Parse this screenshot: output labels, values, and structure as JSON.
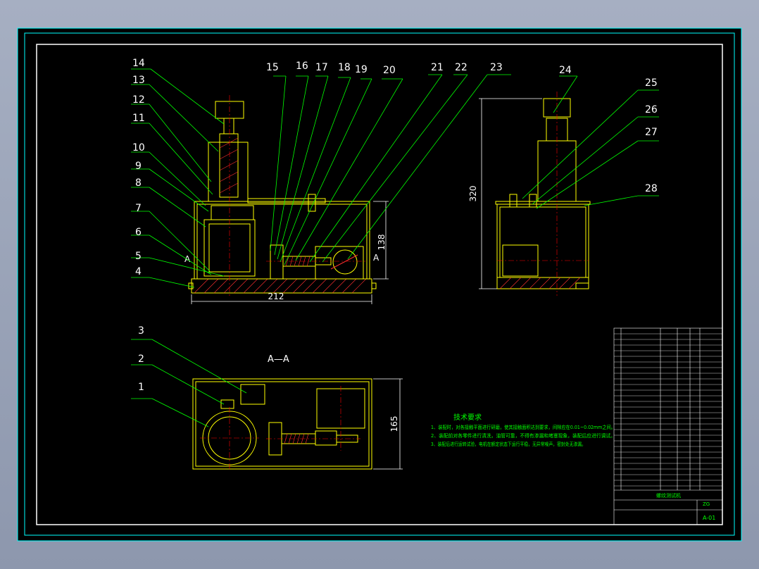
{
  "callouts": {
    "left_stack": [
      "14",
      "13",
      "12",
      "11",
      "10",
      "9",
      "8",
      "7",
      "6",
      "5",
      "4"
    ],
    "top_row": [
      "15",
      "16",
      "17",
      "18",
      "19",
      "20",
      "21",
      "22",
      "23"
    ],
    "side_view": [
      "24",
      "25",
      "26",
      "27",
      "28"
    ],
    "plan_view": [
      "3",
      "2",
      "1"
    ]
  },
  "dimensions": {
    "front_width": "212",
    "front_height": "138",
    "side_height": "320",
    "plan_height": "165"
  },
  "section": {
    "cut_label_left": "A",
    "cut_label_right": "A",
    "view_title": "A—A"
  },
  "notes": {
    "title": "技术要求",
    "lines": [
      "1、装配时，对各接触平面进行研磨，使其接触面积达到要求，间隙应在0.01~0.02mm之间。",
      "2、装配前对各零件进行清洗，油管可靠，不得有渗漏和堵塞现象，装配后应进行调试。",
      "3、装配后进行运转试验，电机在额定状态下运行平稳，无异常噪声，密封处无渗漏。"
    ]
  },
  "title_block": {
    "drawing_number": "A-01",
    "name": "螺纹测试机",
    "material_label": "ZG"
  },
  "colors": {
    "background": "#000000",
    "frame": "#ffffff",
    "outline": "#ffff00",
    "leader": "#00ff00",
    "centerline": "#ff0000",
    "border": "#00ffff"
  }
}
